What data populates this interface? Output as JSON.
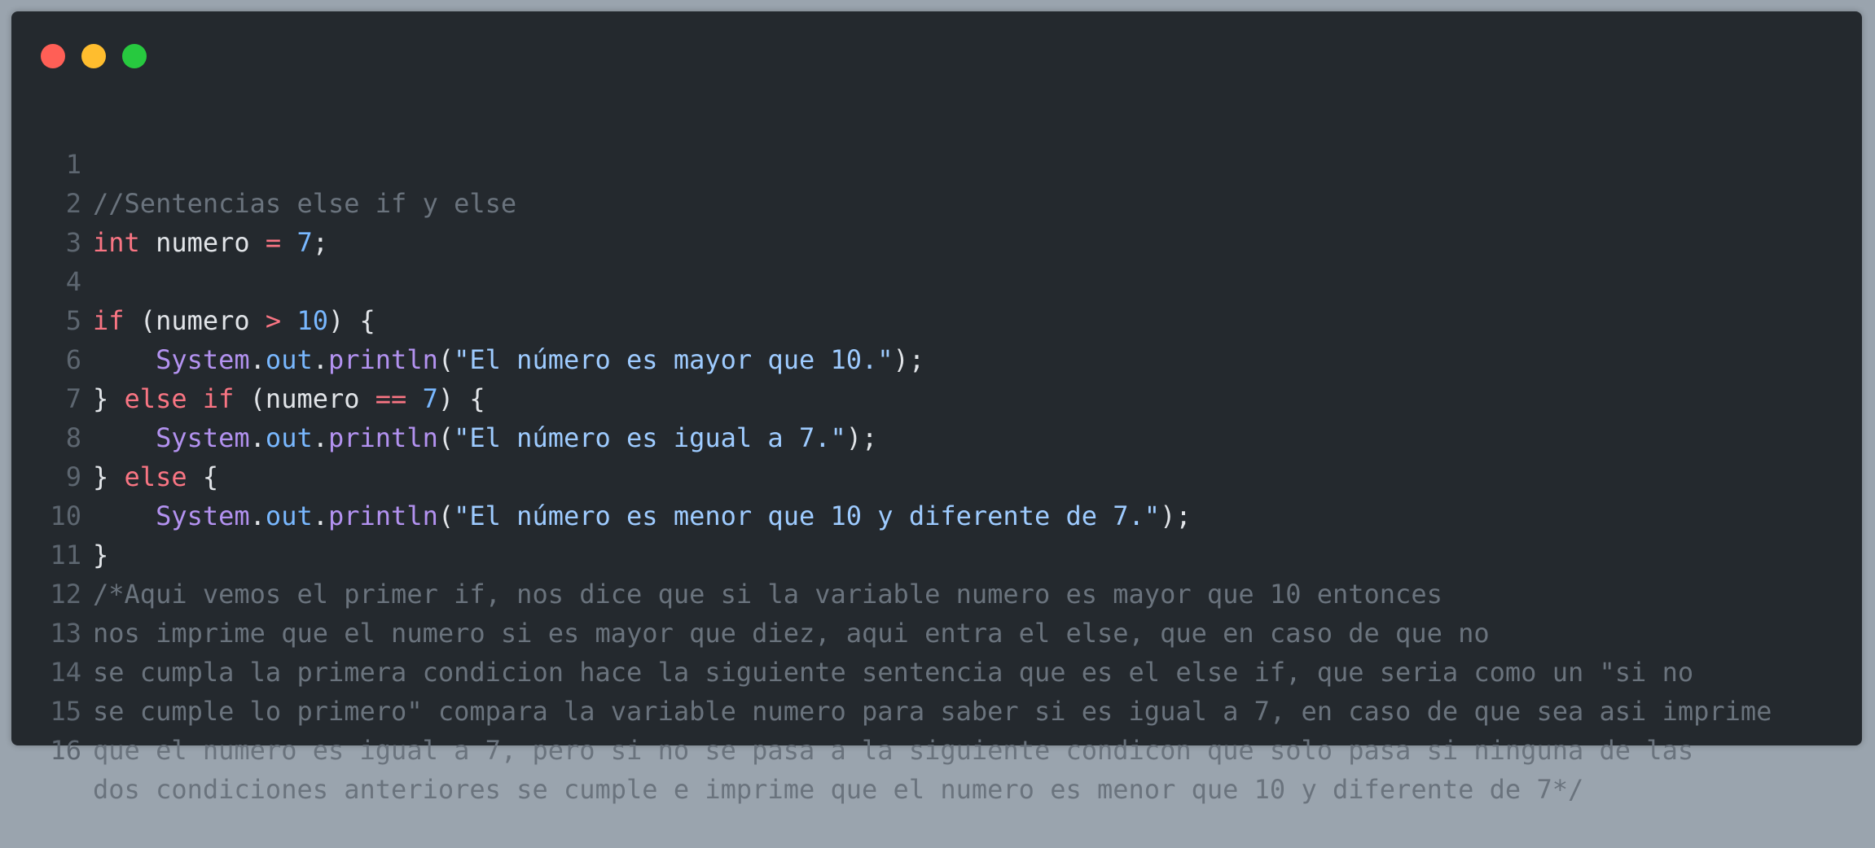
{
  "window": {
    "buttons": {
      "close_color": "#ff5f56",
      "minimize_color": "#ffbd2e",
      "maximize_color": "#27c93f"
    }
  },
  "code": {
    "line_numbers": [
      "1",
      "2",
      "3",
      "4",
      "5",
      "6",
      "7",
      "8",
      "9",
      "10",
      "11",
      "12",
      "13",
      "14",
      "15",
      "16"
    ],
    "tokens": {
      "comment1": "//Sentencias else if y else",
      "kw_int": "int",
      "var_decl": " numero ",
      "op_assign": "=",
      "sp": " ",
      "num_7": "7",
      "semi": ";",
      "kw_if": "if",
      "paren_open_numero": " (numero ",
      "op_gt": ">",
      "num_10": "10",
      "close_brace_open": ") {",
      "indent": "    ",
      "cls_system": "System",
      "dot": ".",
      "fld_out": "out",
      "fn_println": "println",
      "paren_open": "(",
      "str1": "\"El número es mayor que 10.\"",
      "paren_close_semi": ");",
      "brace_close_sp": "} ",
      "kw_else": "else",
      "op_eq": "==",
      "str2": "\"El número es igual a 7.\"",
      "brace_open": " {",
      "str3": "\"El número es menor que 10 y diferente de 7.\"",
      "brace_close": "}",
      "c11": "/*Aqui vemos el primer if, nos dice que si la variable numero es mayor que 10 entonces",
      "c12": "nos imprime que el numero si es mayor que diez, aqui entra el else, que en caso de que no",
      "c13": "se cumpla la primera condicion hace la siguiente sentencia que es el else if, que seria como un \"si no",
      "c14": "se cumple lo primero\" compara la variable numero para saber si es igual a 7, en caso de que sea asi imprime",
      "c15": "que el numero es igual a 7, pero si no se pasa a la siguiente condicon que solo pasa si ninguna de las",
      "c16": "dos condiciones anteriores se cumple e imprime que el numero es menor que 10 y diferente de 7*/"
    }
  }
}
